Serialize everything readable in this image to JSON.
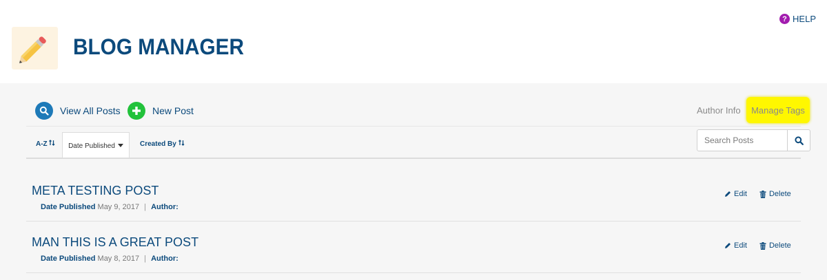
{
  "header": {
    "help_label": "HELP",
    "help_icon": "question-circle-icon",
    "title": "BLOG MANAGER",
    "logo_icon": "pencil-icon"
  },
  "toolbar": {
    "view_all_label": "View All Posts",
    "new_post_label": "New Post",
    "author_info_label": "Author Info",
    "manage_tags_label": "Manage Tags"
  },
  "sort": {
    "az_label": "A-Z",
    "date_label": "Date Published",
    "created_label": "Created By"
  },
  "search": {
    "placeholder": "Search Posts"
  },
  "posts": [
    {
      "title": "META TESTING POST",
      "date_label": "Date Published",
      "date": "May 9, 2017",
      "sep": "|",
      "author_label": "Author:",
      "edit_label": "Edit",
      "delete_label": "Delete"
    },
    {
      "title": "MAN THIS IS A GREAT POST",
      "date_label": "Date Published",
      "date": "May 8, 2017",
      "sep": "|",
      "author_label": "Author:",
      "edit_label": "Edit",
      "delete_label": "Delete"
    }
  ],
  "colors": {
    "primary": "#0c4a7c",
    "highlight": "#fff700",
    "help_icon": "#a21caf",
    "view_all_circle": "#1e7ab8",
    "new_post_circle": "#22c23b",
    "panel_bg": "#f6f6f6"
  }
}
